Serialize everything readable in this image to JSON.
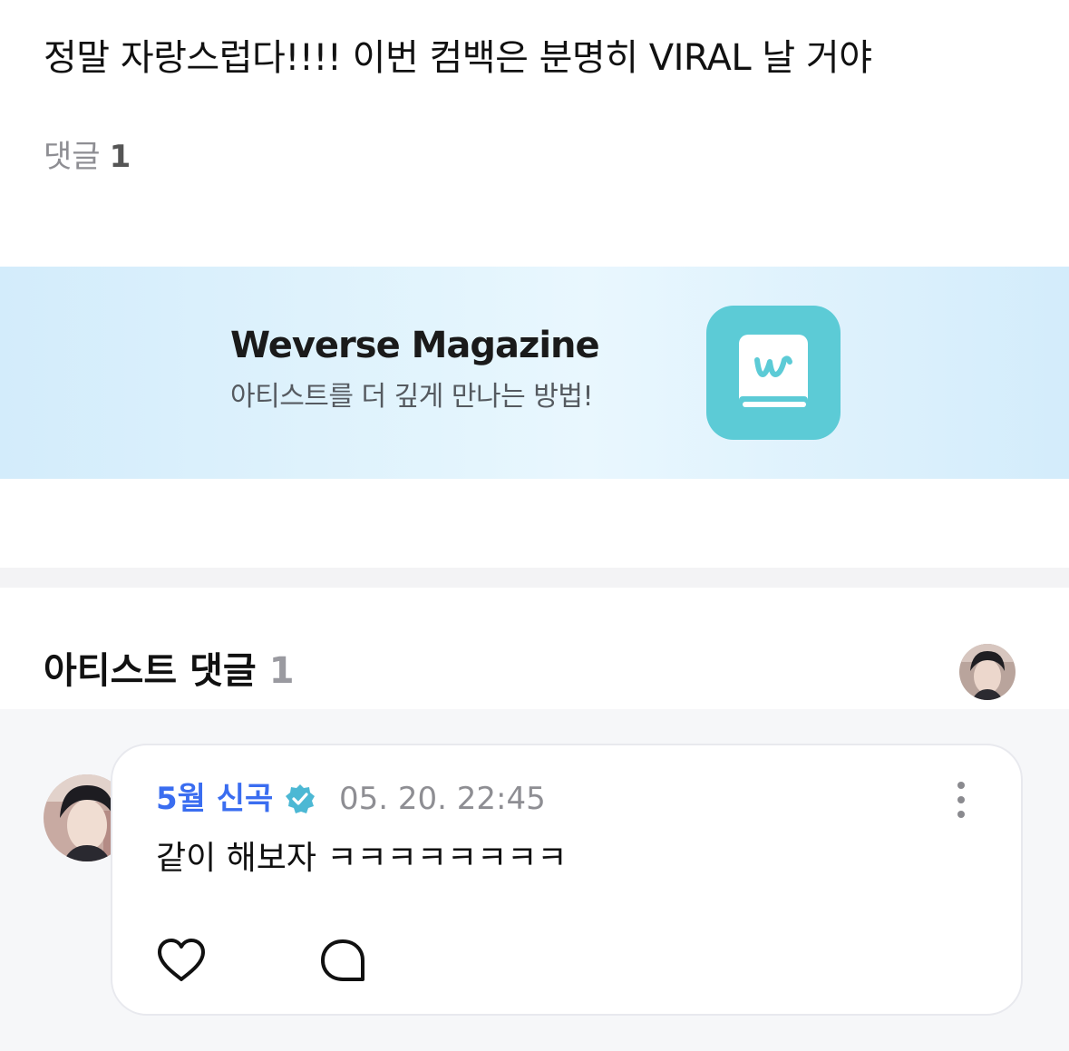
{
  "post": {
    "text": "정말 자랑스럽다!!!! 이번 컴백은 분명히 VIRAL 날 거야",
    "comment_label": "댓글",
    "comment_count": "1"
  },
  "banner": {
    "title": "Weverse Magazine",
    "subtitle": "아티스트를 더 깊게 만나는 방법!",
    "logo_icon": "weverse-magazine-book-icon",
    "logo_color": "#5ccbd6"
  },
  "artist_comments": {
    "title": "아티스트 댓글",
    "count": "1"
  },
  "comment": {
    "author": "5월 신곡",
    "verified_icon": "verified-badge-icon",
    "timestamp": "05. 20. 22:45",
    "body": "같이 해보자 ㅋㅋㅋㅋㅋㅋㅋㅋ",
    "like_icon": "heart-icon",
    "reply_icon": "comment-bubble-icon",
    "more_icon": "more-vertical-icon"
  },
  "colors": {
    "author": "#3a6df0",
    "verified": "#4cb8d4",
    "muted": "#8e8e93"
  }
}
